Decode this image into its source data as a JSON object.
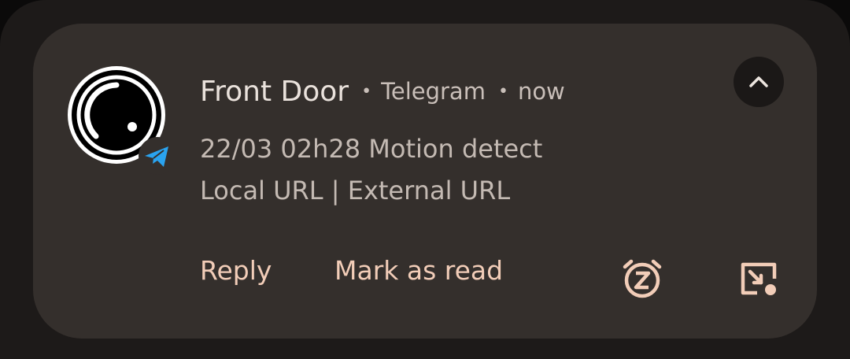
{
  "notification": {
    "title": "Front Door",
    "separator": "•",
    "app_name": "Telegram",
    "time": "now",
    "body_line1": "22/03 02h28 Motion detect",
    "body_line2": "Local URL | External URL",
    "avatar_icon": "camera-lens-icon",
    "badge_icon": "telegram-plane-icon"
  },
  "actions": {
    "reply_label": "Reply",
    "mark_read_label": "Mark as read",
    "snooze_icon": "snooze-alarm-icon",
    "bubble_icon": "open-in-bubble-icon"
  },
  "controls": {
    "expand_icon": "chevron-up-icon"
  },
  "colors": {
    "card_background": "#342f2c",
    "action_accent": "#f2cdb8",
    "telegram_blue": "#2aa3ef"
  }
}
